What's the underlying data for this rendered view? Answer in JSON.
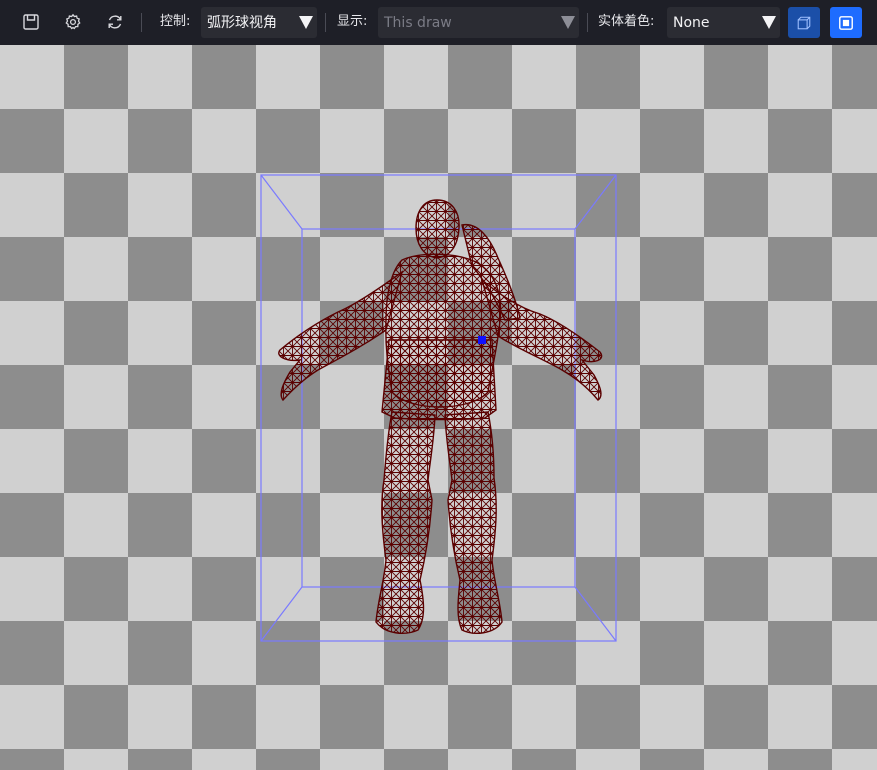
{
  "toolbar": {
    "icons": [
      "save-icon",
      "settings-icon",
      "refresh-icon"
    ],
    "control": {
      "label": "控制:",
      "value": "弧形球视角"
    },
    "display": {
      "label": "显示:",
      "value": "This draw"
    },
    "solid_color": {
      "label": "实体着色:",
      "value": "None"
    },
    "buttons": [
      "wireframe-box-icon",
      "solid-square-icon"
    ]
  },
  "viewport": {
    "background": "checkerboard",
    "checker_colors": [
      "#d0d0d0",
      "#8d8d8d"
    ],
    "bounding_box_color": "#7a7aff",
    "mesh_color": "#5a0000",
    "pivot_color": "#1010ff"
  },
  "colors": {
    "toolbar_bg": "#1e1f27",
    "select_bg": "#2b2c33",
    "button_active": "#1b4fa8",
    "button_primary": "#1e6cff"
  }
}
